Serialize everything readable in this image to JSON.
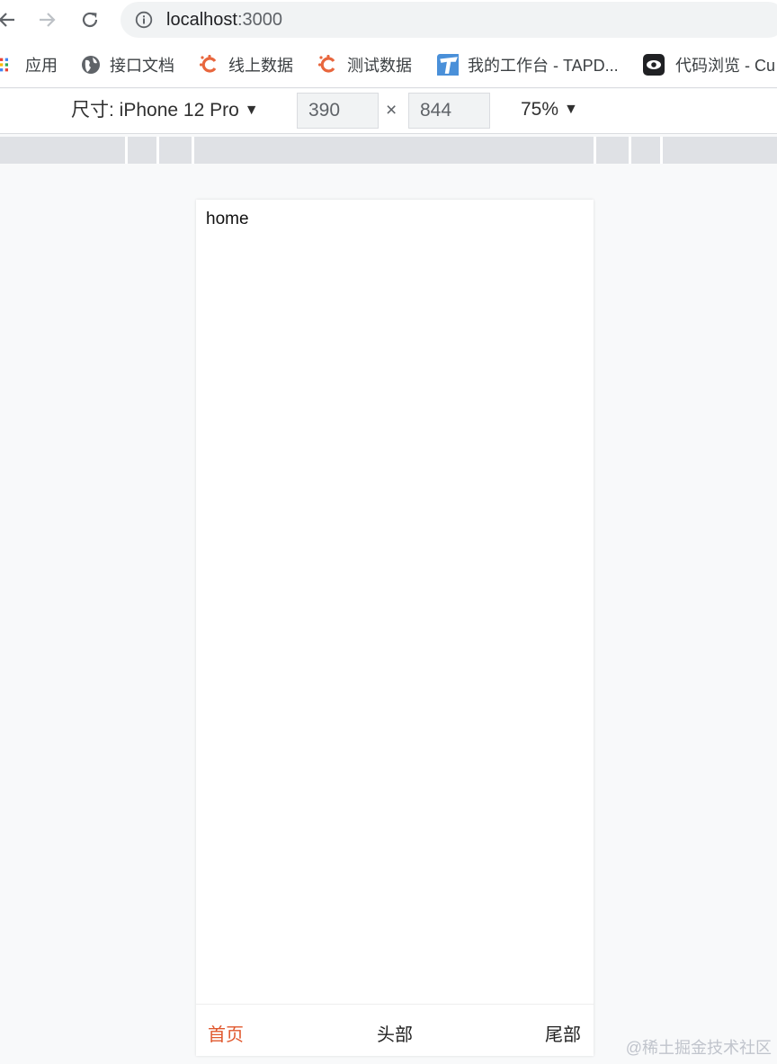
{
  "browser": {
    "url_host": "localhost",
    "url_port": ":3000",
    "icons": {
      "back": "arrow-left-icon",
      "forward": "arrow-right-icon",
      "reload": "reload-icon",
      "info": "info-icon"
    }
  },
  "bookmarks": [
    {
      "label": "应用",
      "icon": "apps-grid-icon"
    },
    {
      "label": "接口文档",
      "icon": "globe-icon"
    },
    {
      "label": "线上数据",
      "icon": "orange-c-icon"
    },
    {
      "label": "测试数据",
      "icon": "orange-c-icon"
    },
    {
      "label": "我的工作台 - TAPD...",
      "icon": "tapd-icon"
    },
    {
      "label": "代码浏览 - Cu",
      "icon": "eye-icon"
    }
  ],
  "device_toolbar": {
    "size_label": "尺寸: iPhone 12 Pro",
    "caret": "▼",
    "width": "390",
    "times": "×",
    "height": "844",
    "zoom": "75%"
  },
  "page": {
    "content_text": "home",
    "tabs": [
      {
        "label": "首页",
        "active": true
      },
      {
        "label": "头部",
        "active": false
      },
      {
        "label": "尾部",
        "active": false
      }
    ]
  },
  "watermark": "@稀土掘金技术社区",
  "colors": {
    "accent": "#e0582e",
    "bookmark_orange": "#e8663d",
    "tapd_blue": "#4a90d9"
  }
}
